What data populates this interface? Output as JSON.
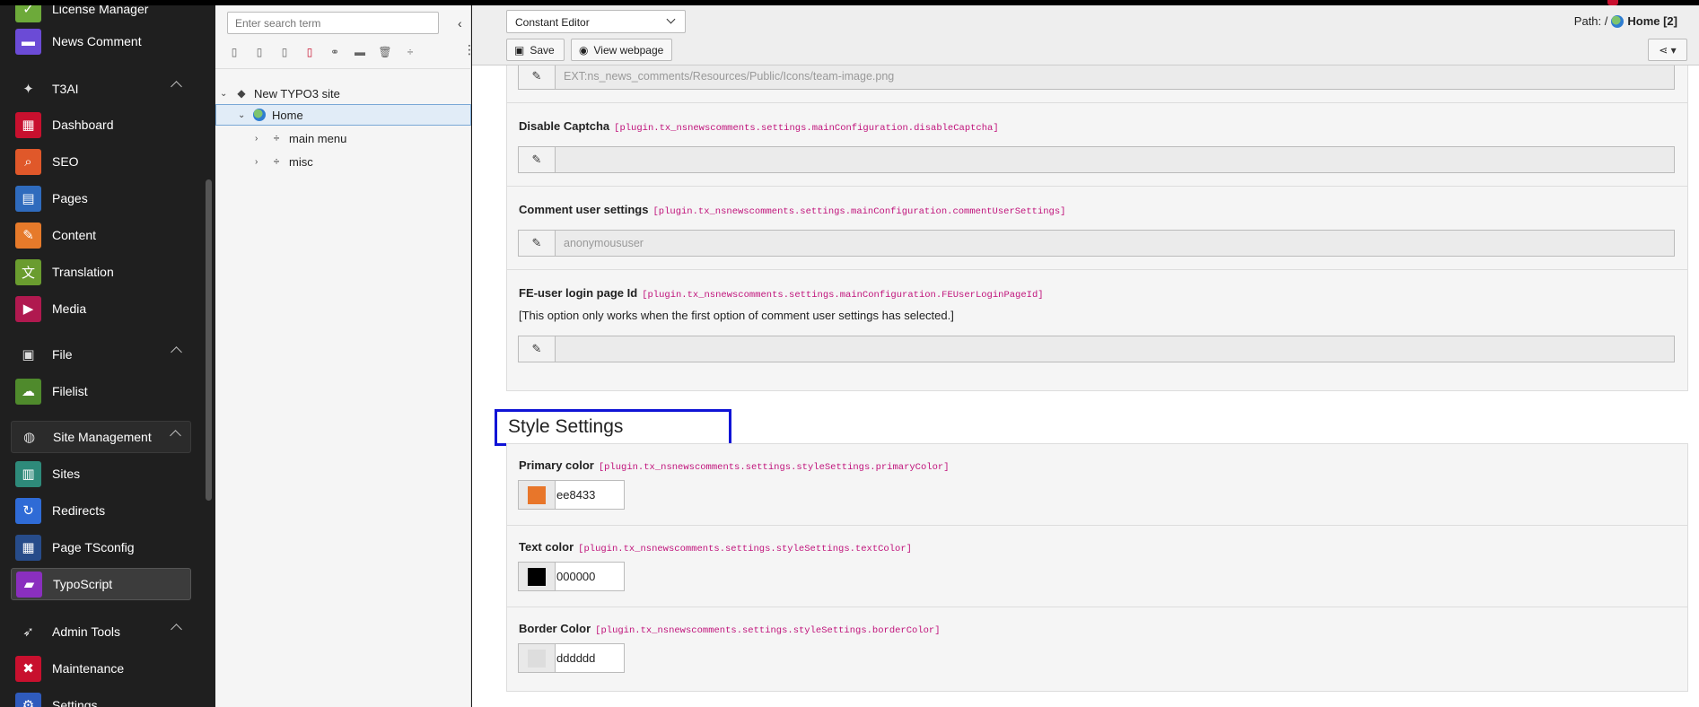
{
  "module_menu": {
    "top_items": [
      {
        "label": "License Manager",
        "icon": "license-icon",
        "color": "#6daa3a"
      },
      {
        "label": "News Comment",
        "icon": "comment-icon",
        "color": "#6b4bd6"
      }
    ],
    "groups": [
      {
        "label": "T3AI",
        "icon": "sparkle-icon",
        "items": [
          {
            "label": "Dashboard",
            "icon": "dashboard-icon",
            "color": "#c8102e"
          },
          {
            "label": "SEO",
            "icon": "seo-icon",
            "color": "#e0582a"
          },
          {
            "label": "Pages",
            "icon": "pages-icon",
            "color": "#2f6bbd"
          },
          {
            "label": "Content",
            "icon": "content-icon",
            "color": "#e67a2a"
          },
          {
            "label": "Translation",
            "icon": "translation-icon",
            "color": "#6a9c2f"
          },
          {
            "label": "Media",
            "icon": "media-icon",
            "color": "#b0194f"
          }
        ]
      },
      {
        "label": "File",
        "icon": "image-icon",
        "items": [
          {
            "label": "Filelist",
            "icon": "filelist-icon",
            "color": "#4f8a2c"
          }
        ]
      },
      {
        "label": "Site Management",
        "icon": "globe-icon",
        "items": [
          {
            "label": "Sites",
            "icon": "sites-icon",
            "color": "#2e8a7a"
          },
          {
            "label": "Redirects",
            "icon": "redirects-icon",
            "color": "#2f6bd6"
          },
          {
            "label": "Page TSconfig",
            "icon": "tsconfig-icon",
            "color": "#274c8a"
          },
          {
            "label": "TypoScript",
            "icon": "typoscript-icon",
            "color": "#8a2fbf"
          }
        ]
      },
      {
        "label": "Admin Tools",
        "icon": "rocket-icon",
        "items": [
          {
            "label": "Maintenance",
            "icon": "maintenance-icon",
            "color": "#c8102e"
          },
          {
            "label": "Settings",
            "icon": "settings-icon",
            "color": "#2f5bbd"
          }
        ]
      }
    ]
  },
  "page_tree": {
    "search_placeholder": "Enter search term",
    "nodes": [
      {
        "label": "New TYPO3 site"
      },
      {
        "label": "Home"
      },
      {
        "label": "main menu"
      },
      {
        "label": "misc"
      }
    ]
  },
  "doc_header": {
    "select_value": "Constant Editor",
    "save_label": "Save",
    "view_label": "View webpage",
    "path_prefix": "Path: /",
    "path_page": "Home [2]"
  },
  "constants": {
    "top_field_value": "EXT:ns_news_comments/Resources/Public/Icons/team-image.png",
    "rows": [
      {
        "label": "Disable Captcha",
        "key": "[plugin.tx_nsnewscomments.settings.mainConfiguration.disableCaptcha]",
        "value": ""
      },
      {
        "label": "Comment user settings",
        "key": "[plugin.tx_nsnewscomments.settings.mainConfiguration.commentUserSettings]",
        "value": "anonymoususer"
      },
      {
        "label": "FE-user login page Id",
        "key": "[plugin.tx_nsnewscomments.settings.mainConfiguration.FEUserLoginPageId]",
        "desc": "[This option only works when the first option of comment user settings has selected.]",
        "value": ""
      }
    ],
    "section_title": "Style Settings",
    "colors": [
      {
        "label": "Primary color",
        "key": "[plugin.tx_nsnewscomments.settings.styleSettings.primaryColor]",
        "value": "ee8433",
        "swatch": "#e8762a"
      },
      {
        "label": "Text color",
        "key": "[plugin.tx_nsnewscomments.settings.styleSettings.textColor]",
        "value": "000000",
        "swatch": "#000000"
      },
      {
        "label": "Border Color",
        "key": "[plugin.tx_nsnewscomments.settings.styleSettings.borderColor]",
        "value": "dddddd",
        "swatch": "#dddddd"
      }
    ]
  }
}
